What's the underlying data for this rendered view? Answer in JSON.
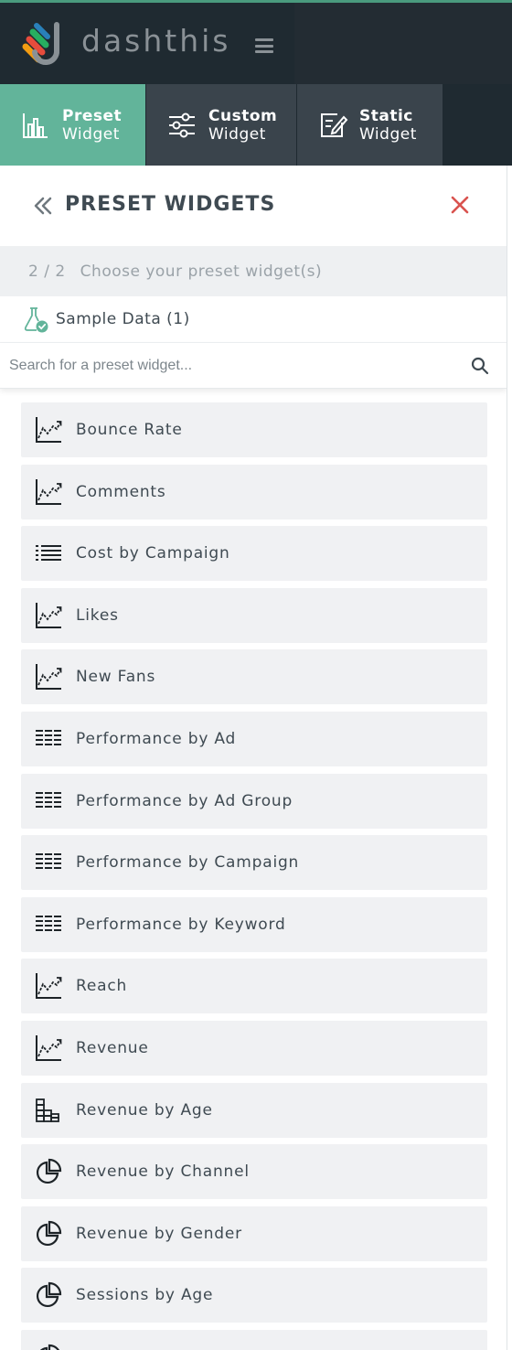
{
  "brand": {
    "name": "dashthis"
  },
  "tabs": [
    {
      "line1": "Preset",
      "line2": "Widget",
      "icon": "bar-chart-icon",
      "active": true
    },
    {
      "line1": "Custom",
      "line2": "Widget",
      "icon": "sliders-icon",
      "active": false
    },
    {
      "line1": "Static",
      "line2": "Widget",
      "icon": "edit-note-icon",
      "active": false
    }
  ],
  "panel": {
    "title": "PRESET WIDGETS",
    "step": "2 / 2",
    "step_text": "Choose your preset widget(s)",
    "source_label": "Sample Data (1)",
    "search_placeholder": "Search for a preset widget..."
  },
  "widgets": [
    {
      "label": "Bounce Rate",
      "icon": "line-chart-icon"
    },
    {
      "label": "Comments",
      "icon": "line-chart-icon"
    },
    {
      "label": "Cost by Campaign",
      "icon": "list-icon"
    },
    {
      "label": "Likes",
      "icon": "line-chart-icon"
    },
    {
      "label": "New Fans",
      "icon": "line-chart-icon"
    },
    {
      "label": "Performance by Ad",
      "icon": "table-icon"
    },
    {
      "label": "Performance by Ad Group",
      "icon": "table-icon"
    },
    {
      "label": "Performance by Campaign",
      "icon": "table-icon"
    },
    {
      "label": "Performance by Keyword",
      "icon": "table-icon"
    },
    {
      "label": "Reach",
      "icon": "line-chart-icon"
    },
    {
      "label": "Revenue",
      "icon": "line-chart-icon"
    },
    {
      "label": "Revenue by Age",
      "icon": "stacked-bar-icon"
    },
    {
      "label": "Revenue by Channel",
      "icon": "pie-chart-icon"
    },
    {
      "label": "Revenue by Gender",
      "icon": "pie-chart-icon"
    },
    {
      "label": "Sessions by Age",
      "icon": "pie-chart-icon"
    },
    {
      "label": "",
      "icon": "pie-chart-icon"
    }
  ],
  "colors": {
    "accent": "#62b49a",
    "topbar": "#1f2a31",
    "tab_inactive": "#3a444c",
    "close": "#d9534f"
  }
}
